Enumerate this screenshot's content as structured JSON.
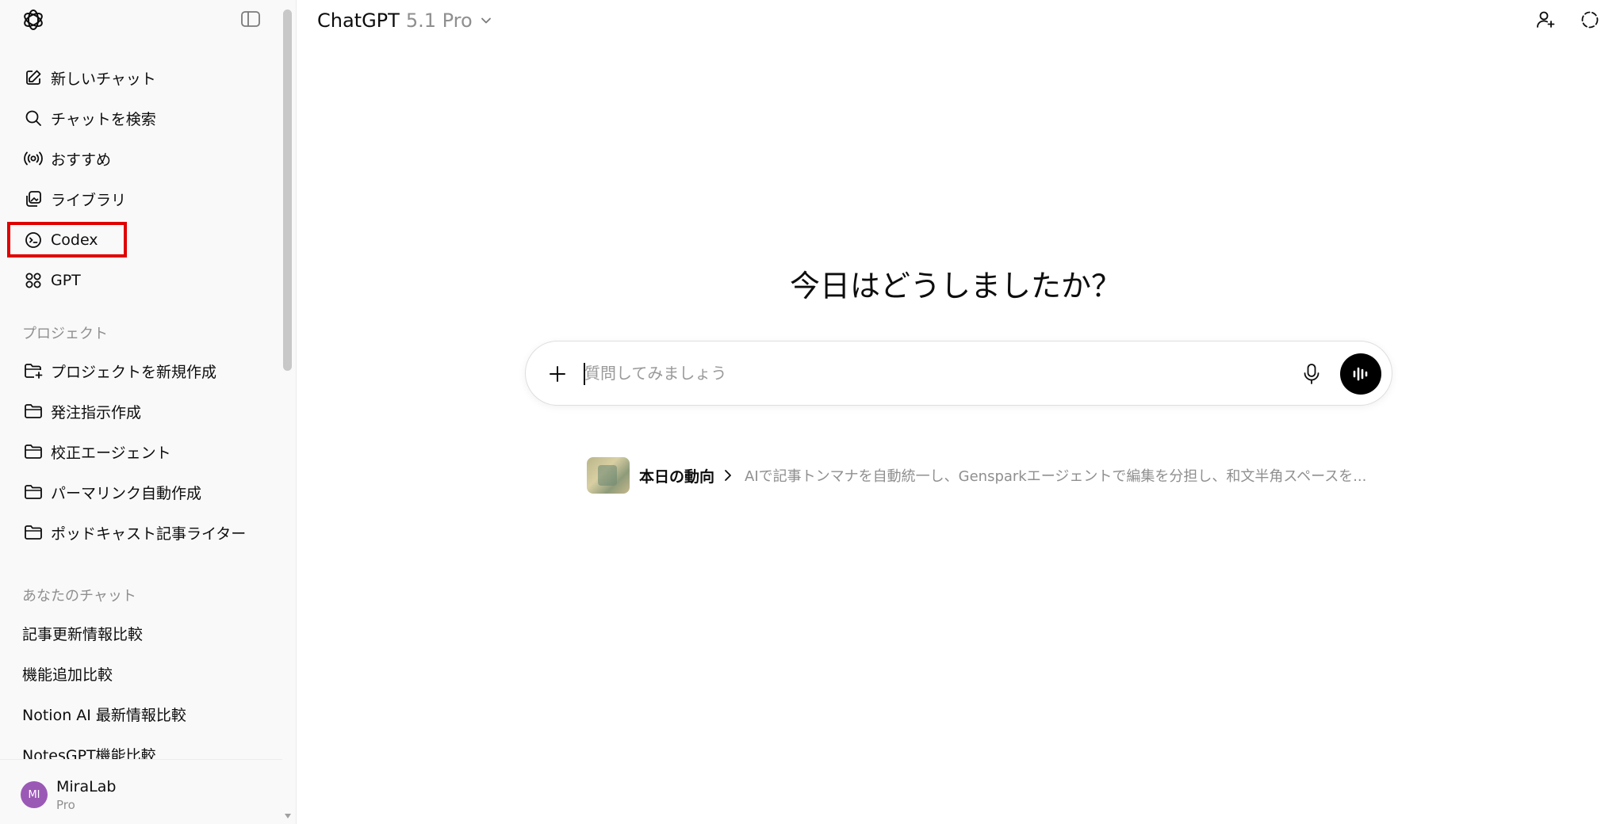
{
  "sidebar": {
    "nav": [
      {
        "label": "新しいチャット",
        "icon": "new-chat-icon"
      },
      {
        "label": "チャットを検索",
        "icon": "search-icon"
      },
      {
        "label": "おすすめ",
        "icon": "broadcast-icon"
      },
      {
        "label": "ライブラリ",
        "icon": "library-icon"
      },
      {
        "label": "Codex",
        "icon": "codex-icon"
      },
      {
        "label": "GPT",
        "icon": "grid-icon"
      }
    ],
    "projects_label": "プロジェクト",
    "projects": [
      {
        "label": "プロジェクトを新規作成",
        "icon": "new-folder-icon"
      },
      {
        "label": "発注指示作成",
        "icon": "folder-icon"
      },
      {
        "label": "校正エージェント",
        "icon": "folder-icon"
      },
      {
        "label": "パーマリンク自動作成",
        "icon": "folder-icon"
      },
      {
        "label": "ポッドキャスト記事ライター",
        "icon": "folder-icon"
      }
    ],
    "chats_label": "あなたのチャット",
    "chats": [
      "記事更新情報比較",
      "機能追加比較",
      "Notion AI 最新情報比較",
      "NotesGPT機能比較"
    ],
    "profile": {
      "initials": "MI",
      "name": "MiraLab",
      "plan": "Pro",
      "avatar_color": "#9b59b6"
    },
    "highlight_color": "#e00000"
  },
  "header": {
    "title": "ChatGPT",
    "model": "5.1 Pro"
  },
  "main": {
    "greeting": "今日はどうしましたか？",
    "composer": {
      "placeholder": "質問してみましょう"
    },
    "trend": {
      "title": "本日の動向",
      "text": "AIで記事トンマナを自動統一し、Gensparkエージェントで編集を分担し、和文半角スペースを..."
    }
  }
}
